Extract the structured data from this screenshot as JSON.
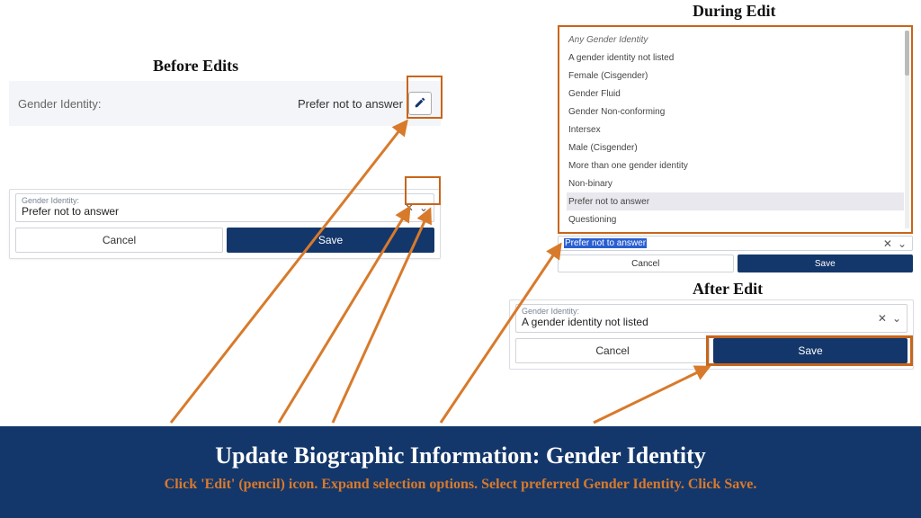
{
  "titles": {
    "before": "Before Edits",
    "during": "During Edit",
    "after": "After Edit"
  },
  "before": {
    "label": "Gender Identity:",
    "value": "Prefer not to answer",
    "field_label": "Gender Identity:",
    "field_value": "Prefer not to answer",
    "cancel": "Cancel",
    "save": "Save"
  },
  "during": {
    "options": [
      "Any Gender Identity",
      "A gender identity not listed",
      "Female (Cisgender)",
      "Gender Fluid",
      "Gender Non-conforming",
      "Intersex",
      "Male (Cisgender)",
      "More than one gender identity",
      "Non-binary",
      "Prefer not to answer",
      "Questioning"
    ],
    "selected_index": 9,
    "input_value": "Prefer not to answer",
    "cancel": "Cancel",
    "save": "Save"
  },
  "after": {
    "field_label": "Gender Identity:",
    "field_value": "A gender identity not listed",
    "cancel": "Cancel",
    "save": "Save"
  },
  "footer": {
    "title": "Update Biographic Information: Gender Identity",
    "sub": "Click 'Edit' (pencil) icon. Expand selection options. Select preferred Gender Identity. Click Save."
  }
}
